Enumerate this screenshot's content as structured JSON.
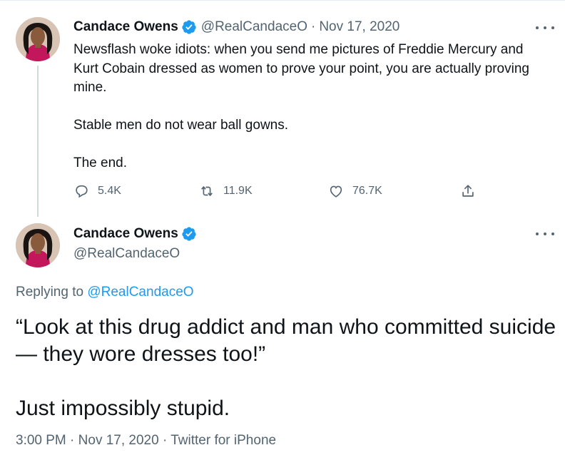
{
  "tweet1": {
    "name": "Candace Owens",
    "handle": "@RealCandaceO",
    "separator": "·",
    "date": "Nov 17, 2020",
    "text": "Newsflash woke idiots: when you send me pictures of Freddie Mercury and Kurt Cobain dressed as women to prove your point, you are actually proving mine.\n\nStable men do not wear ball gowns.\n\nThe end.",
    "actions": {
      "replies": "5.4K",
      "retweets": "11.9K",
      "likes": "76.7K"
    }
  },
  "tweet2": {
    "name": "Candace Owens",
    "handle": "@RealCandaceO",
    "replying_prefix": "Replying to ",
    "replying_to": "@RealCandaceO",
    "text": "“Look at this drug addict and man who committed suicide— they wore dresses too!”\n\nJust impossibly stupid.",
    "time": "3:00 PM",
    "separator": "·",
    "date": "Nov 17, 2020",
    "source": "Twitter for iPhone"
  },
  "colors": {
    "accent": "#1d9bf0",
    "secondary_text": "#536471",
    "primary_text": "#0f1419",
    "thread_line": "#cfd9de"
  },
  "icons": [
    "verified-badge-icon",
    "more-options-icon",
    "reply-icon",
    "retweet-icon",
    "like-icon",
    "share-icon"
  ]
}
